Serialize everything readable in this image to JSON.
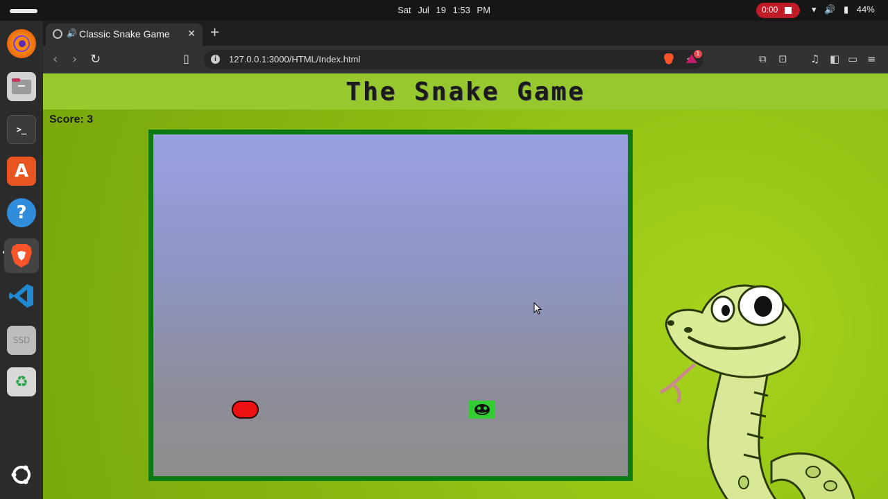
{
  "system": {
    "clock": "Sat Jul 19   1:53 PM",
    "recording_time": "0:00",
    "battery": "44%"
  },
  "dock": {
    "items": [
      "firefox-icon",
      "files-icon",
      "terminal-icon",
      "app-center-icon",
      "help-icon",
      "brave-icon",
      "vscode-icon",
      "ssd-icon",
      "trash-icon",
      "show-apps-icon"
    ],
    "ssd_label": "SSD"
  },
  "browser": {
    "tab_title": "Classic Snake Game",
    "url": "127.0.0.1:3000/HTML/Index.html",
    "notification_count": "1"
  },
  "game": {
    "title": "The Snake Game",
    "score_label": "Score: 3",
    "score": 3,
    "colors": {
      "board_border": "#0d7a13",
      "food": "#ee1111",
      "snake_head": "#33cc33",
      "page_bg": "#8ab812"
    }
  }
}
